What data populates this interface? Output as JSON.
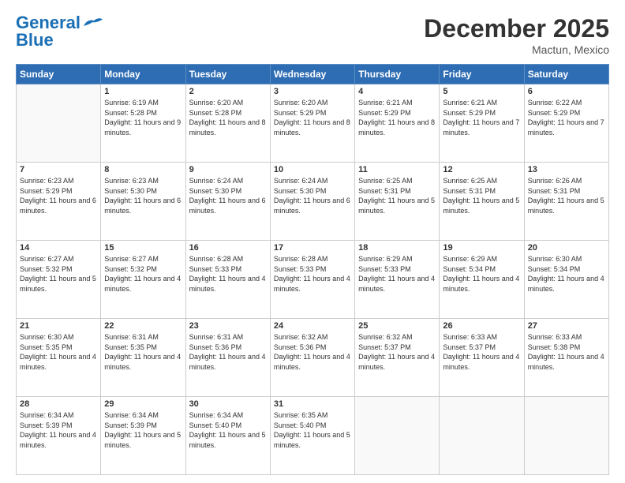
{
  "header": {
    "logo_general": "General",
    "logo_blue": "Blue",
    "month_title": "December 2025",
    "location": "Mactun, Mexico"
  },
  "days_of_week": [
    "Sunday",
    "Monday",
    "Tuesday",
    "Wednesday",
    "Thursday",
    "Friday",
    "Saturday"
  ],
  "weeks": [
    [
      {
        "day": "",
        "sunrise": "",
        "sunset": "",
        "daylight": ""
      },
      {
        "day": "1",
        "sunrise": "Sunrise: 6:19 AM",
        "sunset": "Sunset: 5:28 PM",
        "daylight": "Daylight: 11 hours and 9 minutes."
      },
      {
        "day": "2",
        "sunrise": "Sunrise: 6:20 AM",
        "sunset": "Sunset: 5:28 PM",
        "daylight": "Daylight: 11 hours and 8 minutes."
      },
      {
        "day": "3",
        "sunrise": "Sunrise: 6:20 AM",
        "sunset": "Sunset: 5:29 PM",
        "daylight": "Daylight: 11 hours and 8 minutes."
      },
      {
        "day": "4",
        "sunrise": "Sunrise: 6:21 AM",
        "sunset": "Sunset: 5:29 PM",
        "daylight": "Daylight: 11 hours and 8 minutes."
      },
      {
        "day": "5",
        "sunrise": "Sunrise: 6:21 AM",
        "sunset": "Sunset: 5:29 PM",
        "daylight": "Daylight: 11 hours and 7 minutes."
      },
      {
        "day": "6",
        "sunrise": "Sunrise: 6:22 AM",
        "sunset": "Sunset: 5:29 PM",
        "daylight": "Daylight: 11 hours and 7 minutes."
      }
    ],
    [
      {
        "day": "7",
        "sunrise": "Sunrise: 6:23 AM",
        "sunset": "Sunset: 5:29 PM",
        "daylight": "Daylight: 11 hours and 6 minutes."
      },
      {
        "day": "8",
        "sunrise": "Sunrise: 6:23 AM",
        "sunset": "Sunset: 5:30 PM",
        "daylight": "Daylight: 11 hours and 6 minutes."
      },
      {
        "day": "9",
        "sunrise": "Sunrise: 6:24 AM",
        "sunset": "Sunset: 5:30 PM",
        "daylight": "Daylight: 11 hours and 6 minutes."
      },
      {
        "day": "10",
        "sunrise": "Sunrise: 6:24 AM",
        "sunset": "Sunset: 5:30 PM",
        "daylight": "Daylight: 11 hours and 6 minutes."
      },
      {
        "day": "11",
        "sunrise": "Sunrise: 6:25 AM",
        "sunset": "Sunset: 5:31 PM",
        "daylight": "Daylight: 11 hours and 5 minutes."
      },
      {
        "day": "12",
        "sunrise": "Sunrise: 6:25 AM",
        "sunset": "Sunset: 5:31 PM",
        "daylight": "Daylight: 11 hours and 5 minutes."
      },
      {
        "day": "13",
        "sunrise": "Sunrise: 6:26 AM",
        "sunset": "Sunset: 5:31 PM",
        "daylight": "Daylight: 11 hours and 5 minutes."
      }
    ],
    [
      {
        "day": "14",
        "sunrise": "Sunrise: 6:27 AM",
        "sunset": "Sunset: 5:32 PM",
        "daylight": "Daylight: 11 hours and 5 minutes."
      },
      {
        "day": "15",
        "sunrise": "Sunrise: 6:27 AM",
        "sunset": "Sunset: 5:32 PM",
        "daylight": "Daylight: 11 hours and 4 minutes."
      },
      {
        "day": "16",
        "sunrise": "Sunrise: 6:28 AM",
        "sunset": "Sunset: 5:33 PM",
        "daylight": "Daylight: 11 hours and 4 minutes."
      },
      {
        "day": "17",
        "sunrise": "Sunrise: 6:28 AM",
        "sunset": "Sunset: 5:33 PM",
        "daylight": "Daylight: 11 hours and 4 minutes."
      },
      {
        "day": "18",
        "sunrise": "Sunrise: 6:29 AM",
        "sunset": "Sunset: 5:33 PM",
        "daylight": "Daylight: 11 hours and 4 minutes."
      },
      {
        "day": "19",
        "sunrise": "Sunrise: 6:29 AM",
        "sunset": "Sunset: 5:34 PM",
        "daylight": "Daylight: 11 hours and 4 minutes."
      },
      {
        "day": "20",
        "sunrise": "Sunrise: 6:30 AM",
        "sunset": "Sunset: 5:34 PM",
        "daylight": "Daylight: 11 hours and 4 minutes."
      }
    ],
    [
      {
        "day": "21",
        "sunrise": "Sunrise: 6:30 AM",
        "sunset": "Sunset: 5:35 PM",
        "daylight": "Daylight: 11 hours and 4 minutes."
      },
      {
        "day": "22",
        "sunrise": "Sunrise: 6:31 AM",
        "sunset": "Sunset: 5:35 PM",
        "daylight": "Daylight: 11 hours and 4 minutes."
      },
      {
        "day": "23",
        "sunrise": "Sunrise: 6:31 AM",
        "sunset": "Sunset: 5:36 PM",
        "daylight": "Daylight: 11 hours and 4 minutes."
      },
      {
        "day": "24",
        "sunrise": "Sunrise: 6:32 AM",
        "sunset": "Sunset: 5:36 PM",
        "daylight": "Daylight: 11 hours and 4 minutes."
      },
      {
        "day": "25",
        "sunrise": "Sunrise: 6:32 AM",
        "sunset": "Sunset: 5:37 PM",
        "daylight": "Daylight: 11 hours and 4 minutes."
      },
      {
        "day": "26",
        "sunrise": "Sunrise: 6:33 AM",
        "sunset": "Sunset: 5:37 PM",
        "daylight": "Daylight: 11 hours and 4 minutes."
      },
      {
        "day": "27",
        "sunrise": "Sunrise: 6:33 AM",
        "sunset": "Sunset: 5:38 PM",
        "daylight": "Daylight: 11 hours and 4 minutes."
      }
    ],
    [
      {
        "day": "28",
        "sunrise": "Sunrise: 6:34 AM",
        "sunset": "Sunset: 5:39 PM",
        "daylight": "Daylight: 11 hours and 4 minutes."
      },
      {
        "day": "29",
        "sunrise": "Sunrise: 6:34 AM",
        "sunset": "Sunset: 5:39 PM",
        "daylight": "Daylight: 11 hours and 5 minutes."
      },
      {
        "day": "30",
        "sunrise": "Sunrise: 6:34 AM",
        "sunset": "Sunset: 5:40 PM",
        "daylight": "Daylight: 11 hours and 5 minutes."
      },
      {
        "day": "31",
        "sunrise": "Sunrise: 6:35 AM",
        "sunset": "Sunset: 5:40 PM",
        "daylight": "Daylight: 11 hours and 5 minutes."
      },
      {
        "day": "",
        "sunrise": "",
        "sunset": "",
        "daylight": ""
      },
      {
        "day": "",
        "sunrise": "",
        "sunset": "",
        "daylight": ""
      },
      {
        "day": "",
        "sunrise": "",
        "sunset": "",
        "daylight": ""
      }
    ]
  ]
}
